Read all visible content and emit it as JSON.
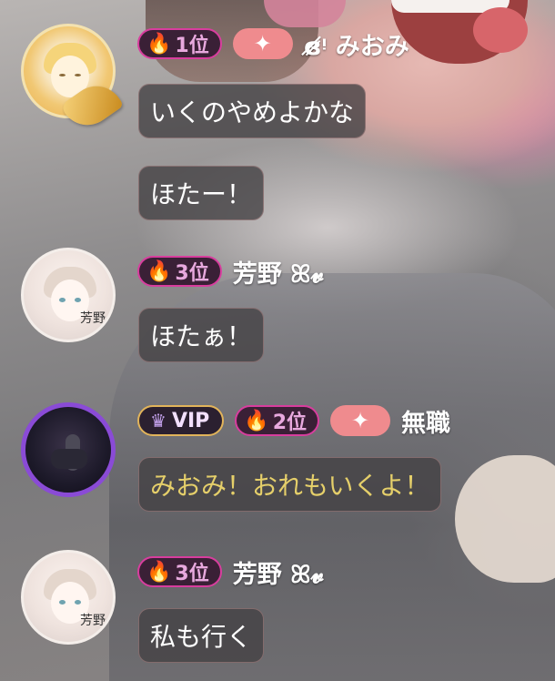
{
  "messages": [
    {
      "user": "ɞ̸̷ᵎ みおみ",
      "rank_label": "1位",
      "sparkle": "✦",
      "avatar_icon": "sunflower-avatar",
      "texts": [
        "いくのやめよかな",
        "ほたー！"
      ]
    },
    {
      "user": "芳野 ꕤ𝓿",
      "rank_label": "3位",
      "avatar_stamp": "芳野",
      "texts": [
        "ほたぁ！"
      ]
    },
    {
      "user": "無職",
      "vip_label": "VIP",
      "rank_label": "2位",
      "sparkle": "✦",
      "texts": [
        "みおみ！おれもいくよ！"
      ]
    },
    {
      "user": "芳野 ꕤ𝓿",
      "rank_label": "3位",
      "avatar_stamp": "芳野",
      "texts": [
        "私も行く"
      ]
    }
  ],
  "colors": {
    "rank_border": "#d83d9e",
    "flame": "#ff7a1a",
    "sparkle_bg": "#ef8b8e",
    "vip_border": "#e2b45a",
    "vip_avatar_ring": "#8a4bd6",
    "highlight_text": "#e5cf6a"
  }
}
